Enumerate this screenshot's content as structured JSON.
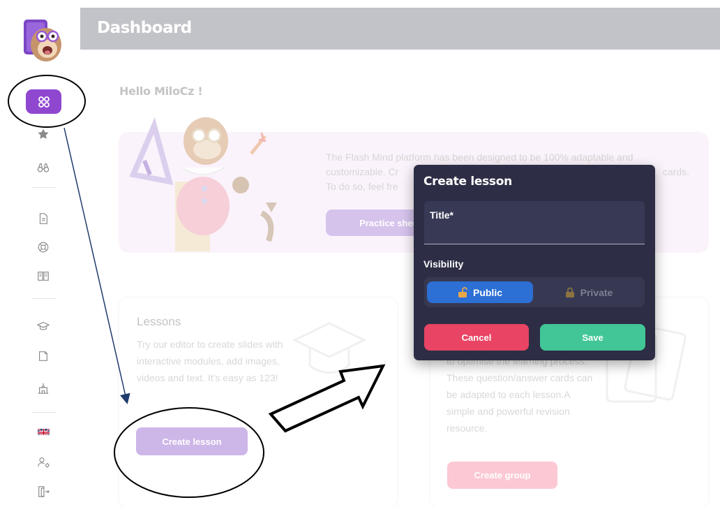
{
  "header": {
    "title": "Dashboard"
  },
  "sidebar": {
    "items": [
      {
        "icon": "dashboard-grid-icon",
        "active": true
      },
      {
        "icon": "star-icon"
      },
      {
        "icon": "binoculars-icon"
      },
      {
        "icon": "document-icon"
      },
      {
        "icon": "lifebuoy-icon"
      },
      {
        "icon": "open-book-icon"
      },
      {
        "icon": "graduation-cap-icon"
      },
      {
        "icon": "note-card-icon"
      },
      {
        "icon": "school-building-icon"
      },
      {
        "icon": "uk-flag-icon"
      },
      {
        "icon": "user-settings-icon"
      },
      {
        "icon": "logout-door-icon"
      }
    ],
    "accent": "#8f47cf"
  },
  "main": {
    "greeting": "Hello MiloCz !",
    "banner": {
      "text_line1": "The Flash Mind platform has been designed to be 100% adaptable and",
      "text_line2_start": "customizable. Cr",
      "text_line2_end": "cards.",
      "text_line3": "To do so, feel fre",
      "button": "Practice shee"
    },
    "lessons": {
      "title": "Lessons",
      "description": "Try our editor to create slides with interactive modules, add images, videos and text. It's easy as 123!",
      "button": "Create lesson"
    },
    "groups": {
      "description": "to optimise the learning process. These question/answer cards can be adapted to each lesson.A simple and powerful revision resource.",
      "button": "Create group"
    }
  },
  "modal": {
    "title": "Create lesson",
    "title_field_label": "Title*",
    "title_field_value": "",
    "visibility_label": "Visibility",
    "visibility_options": [
      "Public",
      "Private"
    ],
    "visibility_selected": "Public",
    "cancel": "Cancel",
    "save": "Save",
    "colors": {
      "background": "#2d2e45",
      "public": "#2c6fd5",
      "cancel": "#e94463",
      "save": "#42c697"
    }
  }
}
